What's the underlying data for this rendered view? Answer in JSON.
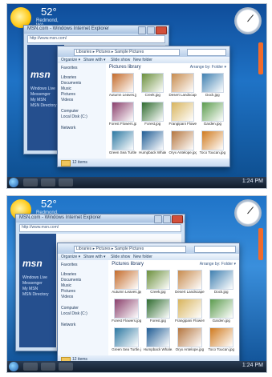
{
  "top": {
    "weather": {
      "temp": "52°",
      "location": "Redmond, WA"
    },
    "ie": {
      "title": "MSN.com - Windows Internet Explorer",
      "address": "http://www.msn.com/",
      "logo": "msn",
      "links": [
        "Windows Live",
        "Messenger",
        "My MSN",
        "MSN Directory"
      ]
    },
    "explorer": {
      "title": "Pictures",
      "path": "Libraries ▸ Pictures ▸ Sample Pictures",
      "toolbar": [
        "Organize ▾",
        "Share with ▾",
        "Slide show",
        "New folder"
      ],
      "nav": [
        "Favorites",
        "Libraries",
        "Documents",
        "Music",
        "Pictures",
        "Videos",
        "Computer",
        "Local Disk (C:)",
        "Network"
      ],
      "library_title": "Pictures library",
      "arrange": "Arrange by: Folder ▾",
      "thumbs": [
        {
          "name": "Autumn Leaves.jpg",
          "color": "#c46b2a"
        },
        {
          "name": "Creek.jpg",
          "color": "#6b8f3c"
        },
        {
          "name": "Desert Landscape.jpg",
          "color": "#c78b4d"
        },
        {
          "name": "Dock.jpg",
          "color": "#3f7fb0"
        },
        {
          "name": "Forest Flowers.jpg",
          "color": "#8a3f6b"
        },
        {
          "name": "Forest.jpg",
          "color": "#2f6b2f"
        },
        {
          "name": "Frangipani Flowers.jpg",
          "color": "#d8b45c"
        },
        {
          "name": "Garden.jpg",
          "color": "#5b9b4d"
        },
        {
          "name": "Green Sea Turtle.jpg",
          "color": "#2c78a2"
        },
        {
          "name": "Humpback Whale.jpg",
          "color": "#1f5c94"
        },
        {
          "name": "Oryx Antelope.jpg",
          "color": "#b5763f"
        },
        {
          "name": "Toco Toucan.jpg",
          "color": "#d07a1e"
        }
      ],
      "status": "12 items"
    },
    "taskbar_clock": "1:24 PM"
  },
  "bottom": {
    "weather": {
      "temp": "52°",
      "location": "Redmond, WA"
    },
    "ie": {
      "title": "MSN.com - Windows Internet Explorer",
      "address": "http://www.msn.com/",
      "logo": "msn",
      "links": [
        "Windows Live",
        "Messenger",
        "My MSN",
        "MSN Directory"
      ]
    },
    "explorer": {
      "title": "Pictures",
      "path": "Libraries ▸ Pictures ▸ Sample Pictures",
      "toolbar": [
        "Organize ▾",
        "Share with ▾",
        "Slide show",
        "New folder"
      ],
      "nav": [
        "Favorites",
        "Libraries",
        "Documents",
        "Music",
        "Pictures",
        "Videos",
        "Computer",
        "Local Disk (C:)",
        "Network"
      ],
      "library_title": "Pictures library",
      "arrange": "Arrange by: Folder ▾",
      "thumbs": [
        {
          "name": "Autumn Leaves.jpg",
          "color": "#c46b2a"
        },
        {
          "name": "Creek.jpg",
          "color": "#6b8f3c"
        },
        {
          "name": "Desert Landscape.jpg",
          "color": "#c78b4d"
        },
        {
          "name": "Dock.jpg",
          "color": "#3f7fb0"
        },
        {
          "name": "Forest Flowers.jpg",
          "color": "#8a3f6b"
        },
        {
          "name": "Forest.jpg",
          "color": "#2f6b2f"
        },
        {
          "name": "Frangipani Flowers.jpg",
          "color": "#d8b45c"
        },
        {
          "name": "Garden.jpg",
          "color": "#5b9b4d"
        },
        {
          "name": "Green Sea Turtle.jpg",
          "color": "#2c78a2"
        },
        {
          "name": "Humpback Whale.jpg",
          "color": "#1f5c94"
        },
        {
          "name": "Oryx Antelope.jpg",
          "color": "#b5763f"
        },
        {
          "name": "Toco Toucan.jpg",
          "color": "#d07a1e"
        }
      ],
      "status": "12 items"
    },
    "taskbar_clock": "1:24 PM"
  }
}
